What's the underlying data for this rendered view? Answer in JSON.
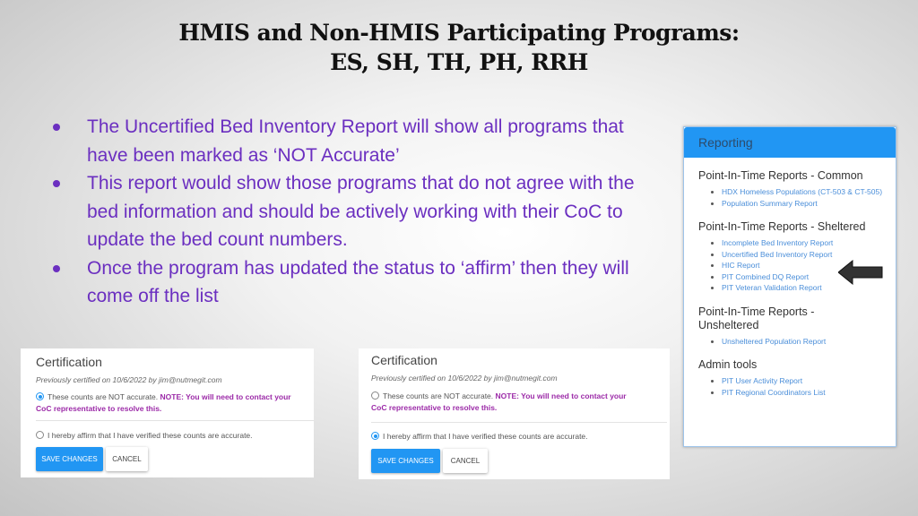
{
  "slide": {
    "title_line1": "HMIS and Non-HMIS Participating Programs:",
    "title_line2": "ES, SH, TH, PH, RRH",
    "bullets": [
      "The Uncertified Bed Inventory Report will show all programs that have been marked as ‘NOT Accurate’",
      "This report would show those programs that do not agree with the bed information and should be actively working with their CoC to update the bed count numbers.",
      "Once the program has updated the status to ‘affirm’ then they will come off the list"
    ]
  },
  "reporting_panel": {
    "header": "Reporting",
    "sections": [
      {
        "title": "Point-In-Time Reports - Common",
        "links": [
          "HDX Homeless Populations (CT-503 & CT-505)",
          "Population Summary Report"
        ]
      },
      {
        "title": "Point-In-Time Reports - Sheltered",
        "links": [
          "Incomplete Bed Inventory Report",
          "Uncertified Bed Inventory Report",
          "HIC Report",
          "PIT Combined DQ Report",
          "PIT Veteran Validation Report"
        ]
      },
      {
        "title": "Point-In-Time Reports - Unsheltered",
        "links": [
          "Unsheltered Population Report"
        ]
      },
      {
        "title": "Admin tools",
        "links": [
          "PIT User Activity Report",
          "PIT Regional Coordinators List"
        ]
      }
    ],
    "highlighted_link": "Uncertified Bed Inventory Report"
  },
  "certification_forms": [
    {
      "title": "Certification",
      "previously": "Previously certified on 10/6/2022 by jim@nutmegit.com",
      "not_accurate_label": "These counts are NOT accurate.",
      "note": "NOTE: You will need to contact your CoC representative to resolve this.",
      "affirm_label": "I hereby affirm that I have verified these counts are accurate.",
      "selected": "not_accurate",
      "save": "SAVE CHANGES",
      "cancel": "CANCEL"
    },
    {
      "title": "Certification",
      "previously": "Previously certified on 10/6/2022 by jim@nutmegit.com",
      "not_accurate_label": "These counts are NOT accurate.",
      "note": "NOTE: You will need to contact your CoC representative to resolve this.",
      "affirm_label": "I hereby affirm that I have verified these counts are accurate.",
      "selected": "affirm",
      "save": "SAVE CHANGES",
      "cancel": "CANCEL"
    }
  ],
  "colors": {
    "accent_blue": "#2196f3",
    "bullet_purple": "#6b2fc0",
    "note_purple": "#9c2ba8",
    "link_blue": "#4a8ed9"
  }
}
